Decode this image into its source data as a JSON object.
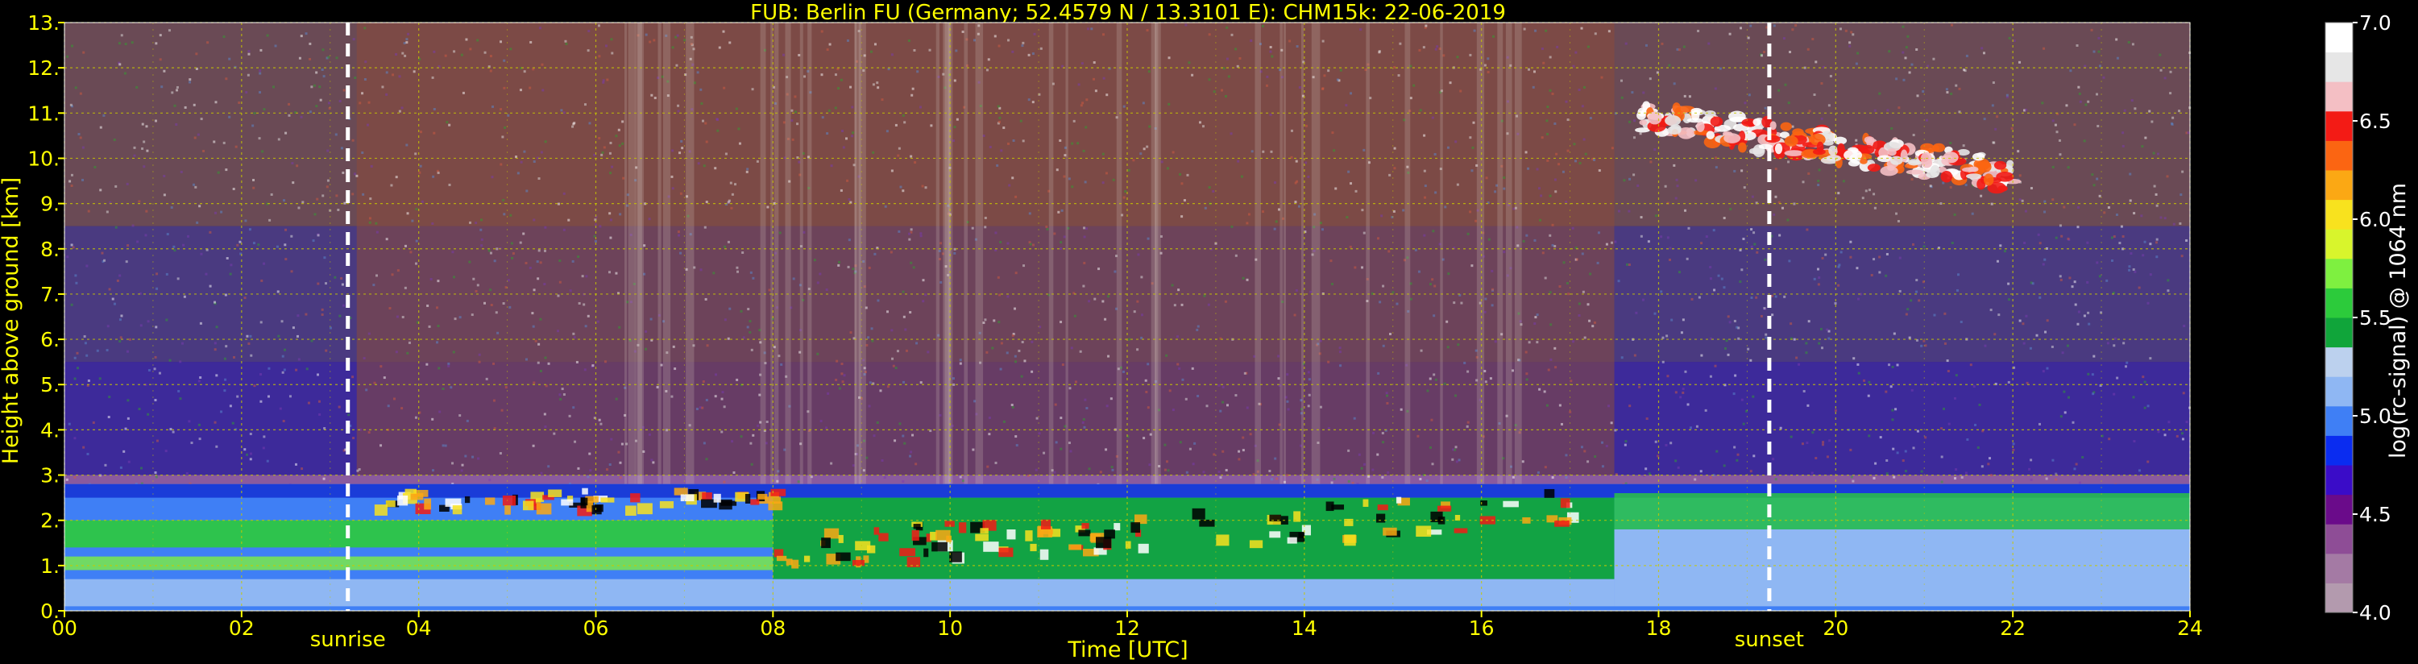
{
  "chart_data": {
    "type": "heatmap",
    "title": "FUB: Berlin FU (Germany; 52.4579 N / 13.3101 E):    CHM15k: 22-06-2019",
    "xlabel": "Time [UTC]",
    "ylabel": "Height above ground [km]",
    "xlim": [
      0,
      24
    ],
    "ylim": [
      0,
      13
    ],
    "x_ticks": [
      {
        "value": 0,
        "label": "00"
      },
      {
        "value": 2,
        "label": "02"
      },
      {
        "value": 4,
        "label": "04"
      },
      {
        "value": 6,
        "label": "06"
      },
      {
        "value": 8,
        "label": "08"
      },
      {
        "value": 10,
        "label": "10"
      },
      {
        "value": 12,
        "label": "12"
      },
      {
        "value": 14,
        "label": "14"
      },
      {
        "value": 16,
        "label": "16"
      },
      {
        "value": 18,
        "label": "18"
      },
      {
        "value": 20,
        "label": "20"
      },
      {
        "value": 22,
        "label": "22"
      },
      {
        "value": 24,
        "label": "24"
      }
    ],
    "y_ticks": [
      {
        "value": 0,
        "label": "0."
      },
      {
        "value": 1,
        "label": "1."
      },
      {
        "value": 2,
        "label": "2."
      },
      {
        "value": 3,
        "label": "3."
      },
      {
        "value": 4,
        "label": "4."
      },
      {
        "value": 5,
        "label": "5."
      },
      {
        "value": 6,
        "label": "6."
      },
      {
        "value": 7,
        "label": "7."
      },
      {
        "value": 8,
        "label": "8."
      },
      {
        "value": 9,
        "label": "9."
      },
      {
        "value": 10,
        "label": "10."
      },
      {
        "value": 11,
        "label": "11."
      },
      {
        "value": 12,
        "label": "12."
      },
      {
        "value": 13,
        "label": "13."
      }
    ],
    "grid": true,
    "annotations": [
      {
        "text": "sunrise",
        "x": 3.2
      },
      {
        "text": "sunset",
        "x": 19.25
      }
    ],
    "colorbar": {
      "label": "log(rc-signal) @ 1064 nm",
      "range": [
        4.0,
        7.0
      ],
      "ticks": [
        {
          "value": 4.0,
          "label": "4.0"
        },
        {
          "value": 4.5,
          "label": "4.5"
        },
        {
          "value": 5.0,
          "label": "5.0"
        },
        {
          "value": 5.5,
          "label": "5.5"
        },
        {
          "value": 6.0,
          "label": "6.0"
        },
        {
          "value": 6.5,
          "label": "6.5"
        },
        {
          "value": 7.0,
          "label": "7.0"
        }
      ],
      "colors": [
        "#b39aae",
        "#a47aa4",
        "#8e4d96",
        "#6a0b8a",
        "#3a0cc8",
        "#0a2cf0",
        "#3f7ff5",
        "#8fb7f3",
        "#bcd1ee",
        "#10a53a",
        "#2ccb3b",
        "#7ef040",
        "#d8f52c",
        "#f8e21e",
        "#fba814",
        "#fb6512",
        "#f31b15",
        "#f4bfc4",
        "#e6e6e6",
        "#ffffff"
      ]
    },
    "features": [
      {
        "type": "boundary_layer_top",
        "time_range": [
          0,
          24
        ],
        "height_km": [
          2.5,
          2.8
        ]
      },
      {
        "type": "aerosol_layer",
        "time_range": [
          0,
          8
        ],
        "height_km": [
          1.4,
          2.0
        ]
      },
      {
        "type": "aerosol_layer",
        "time_range": [
          8,
          17.5
        ],
        "height_km": [
          0.7,
          2.5
        ]
      },
      {
        "type": "cirrus_cloud",
        "time_range": [
          17.7,
          22.0
        ],
        "height_km": [
          9.2,
          11.2
        ]
      }
    ]
  }
}
